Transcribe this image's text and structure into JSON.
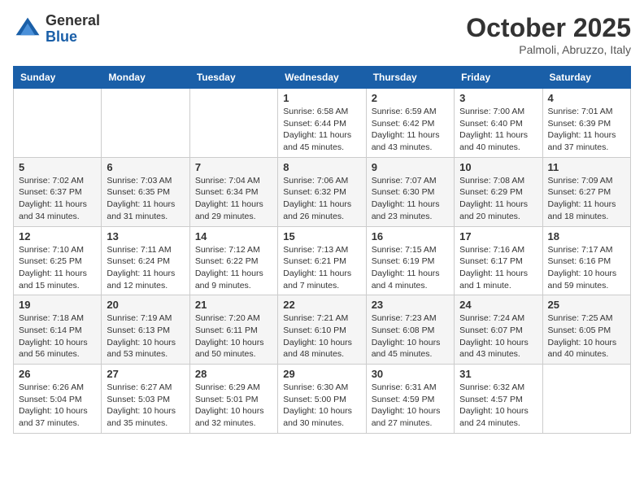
{
  "logo": {
    "general": "General",
    "blue": "Blue"
  },
  "header": {
    "month": "October 2025",
    "location": "Palmoli, Abruzzo, Italy"
  },
  "weekdays": [
    "Sunday",
    "Monday",
    "Tuesday",
    "Wednesday",
    "Thursday",
    "Friday",
    "Saturday"
  ],
  "weeks": [
    [
      {
        "day": "",
        "info": ""
      },
      {
        "day": "",
        "info": ""
      },
      {
        "day": "",
        "info": ""
      },
      {
        "day": "1",
        "info": "Sunrise: 6:58 AM\nSunset: 6:44 PM\nDaylight: 11 hours and 45 minutes."
      },
      {
        "day": "2",
        "info": "Sunrise: 6:59 AM\nSunset: 6:42 PM\nDaylight: 11 hours and 43 minutes."
      },
      {
        "day": "3",
        "info": "Sunrise: 7:00 AM\nSunset: 6:40 PM\nDaylight: 11 hours and 40 minutes."
      },
      {
        "day": "4",
        "info": "Sunrise: 7:01 AM\nSunset: 6:39 PM\nDaylight: 11 hours and 37 minutes."
      }
    ],
    [
      {
        "day": "5",
        "info": "Sunrise: 7:02 AM\nSunset: 6:37 PM\nDaylight: 11 hours and 34 minutes."
      },
      {
        "day": "6",
        "info": "Sunrise: 7:03 AM\nSunset: 6:35 PM\nDaylight: 11 hours and 31 minutes."
      },
      {
        "day": "7",
        "info": "Sunrise: 7:04 AM\nSunset: 6:34 PM\nDaylight: 11 hours and 29 minutes."
      },
      {
        "day": "8",
        "info": "Sunrise: 7:06 AM\nSunset: 6:32 PM\nDaylight: 11 hours and 26 minutes."
      },
      {
        "day": "9",
        "info": "Sunrise: 7:07 AM\nSunset: 6:30 PM\nDaylight: 11 hours and 23 minutes."
      },
      {
        "day": "10",
        "info": "Sunrise: 7:08 AM\nSunset: 6:29 PM\nDaylight: 11 hours and 20 minutes."
      },
      {
        "day": "11",
        "info": "Sunrise: 7:09 AM\nSunset: 6:27 PM\nDaylight: 11 hours and 18 minutes."
      }
    ],
    [
      {
        "day": "12",
        "info": "Sunrise: 7:10 AM\nSunset: 6:25 PM\nDaylight: 11 hours and 15 minutes."
      },
      {
        "day": "13",
        "info": "Sunrise: 7:11 AM\nSunset: 6:24 PM\nDaylight: 11 hours and 12 minutes."
      },
      {
        "day": "14",
        "info": "Sunrise: 7:12 AM\nSunset: 6:22 PM\nDaylight: 11 hours and 9 minutes."
      },
      {
        "day": "15",
        "info": "Sunrise: 7:13 AM\nSunset: 6:21 PM\nDaylight: 11 hours and 7 minutes."
      },
      {
        "day": "16",
        "info": "Sunrise: 7:15 AM\nSunset: 6:19 PM\nDaylight: 11 hours and 4 minutes."
      },
      {
        "day": "17",
        "info": "Sunrise: 7:16 AM\nSunset: 6:17 PM\nDaylight: 11 hours and 1 minute."
      },
      {
        "day": "18",
        "info": "Sunrise: 7:17 AM\nSunset: 6:16 PM\nDaylight: 10 hours and 59 minutes."
      }
    ],
    [
      {
        "day": "19",
        "info": "Sunrise: 7:18 AM\nSunset: 6:14 PM\nDaylight: 10 hours and 56 minutes."
      },
      {
        "day": "20",
        "info": "Sunrise: 7:19 AM\nSunset: 6:13 PM\nDaylight: 10 hours and 53 minutes."
      },
      {
        "day": "21",
        "info": "Sunrise: 7:20 AM\nSunset: 6:11 PM\nDaylight: 10 hours and 50 minutes."
      },
      {
        "day": "22",
        "info": "Sunrise: 7:21 AM\nSunset: 6:10 PM\nDaylight: 10 hours and 48 minutes."
      },
      {
        "day": "23",
        "info": "Sunrise: 7:23 AM\nSunset: 6:08 PM\nDaylight: 10 hours and 45 minutes."
      },
      {
        "day": "24",
        "info": "Sunrise: 7:24 AM\nSunset: 6:07 PM\nDaylight: 10 hours and 43 minutes."
      },
      {
        "day": "25",
        "info": "Sunrise: 7:25 AM\nSunset: 6:05 PM\nDaylight: 10 hours and 40 minutes."
      }
    ],
    [
      {
        "day": "26",
        "info": "Sunrise: 6:26 AM\nSunset: 5:04 PM\nDaylight: 10 hours and 37 minutes."
      },
      {
        "day": "27",
        "info": "Sunrise: 6:27 AM\nSunset: 5:03 PM\nDaylight: 10 hours and 35 minutes."
      },
      {
        "day": "28",
        "info": "Sunrise: 6:29 AM\nSunset: 5:01 PM\nDaylight: 10 hours and 32 minutes."
      },
      {
        "day": "29",
        "info": "Sunrise: 6:30 AM\nSunset: 5:00 PM\nDaylight: 10 hours and 30 minutes."
      },
      {
        "day": "30",
        "info": "Sunrise: 6:31 AM\nSunset: 4:59 PM\nDaylight: 10 hours and 27 minutes."
      },
      {
        "day": "31",
        "info": "Sunrise: 6:32 AM\nSunset: 4:57 PM\nDaylight: 10 hours and 24 minutes."
      },
      {
        "day": "",
        "info": ""
      }
    ]
  ]
}
